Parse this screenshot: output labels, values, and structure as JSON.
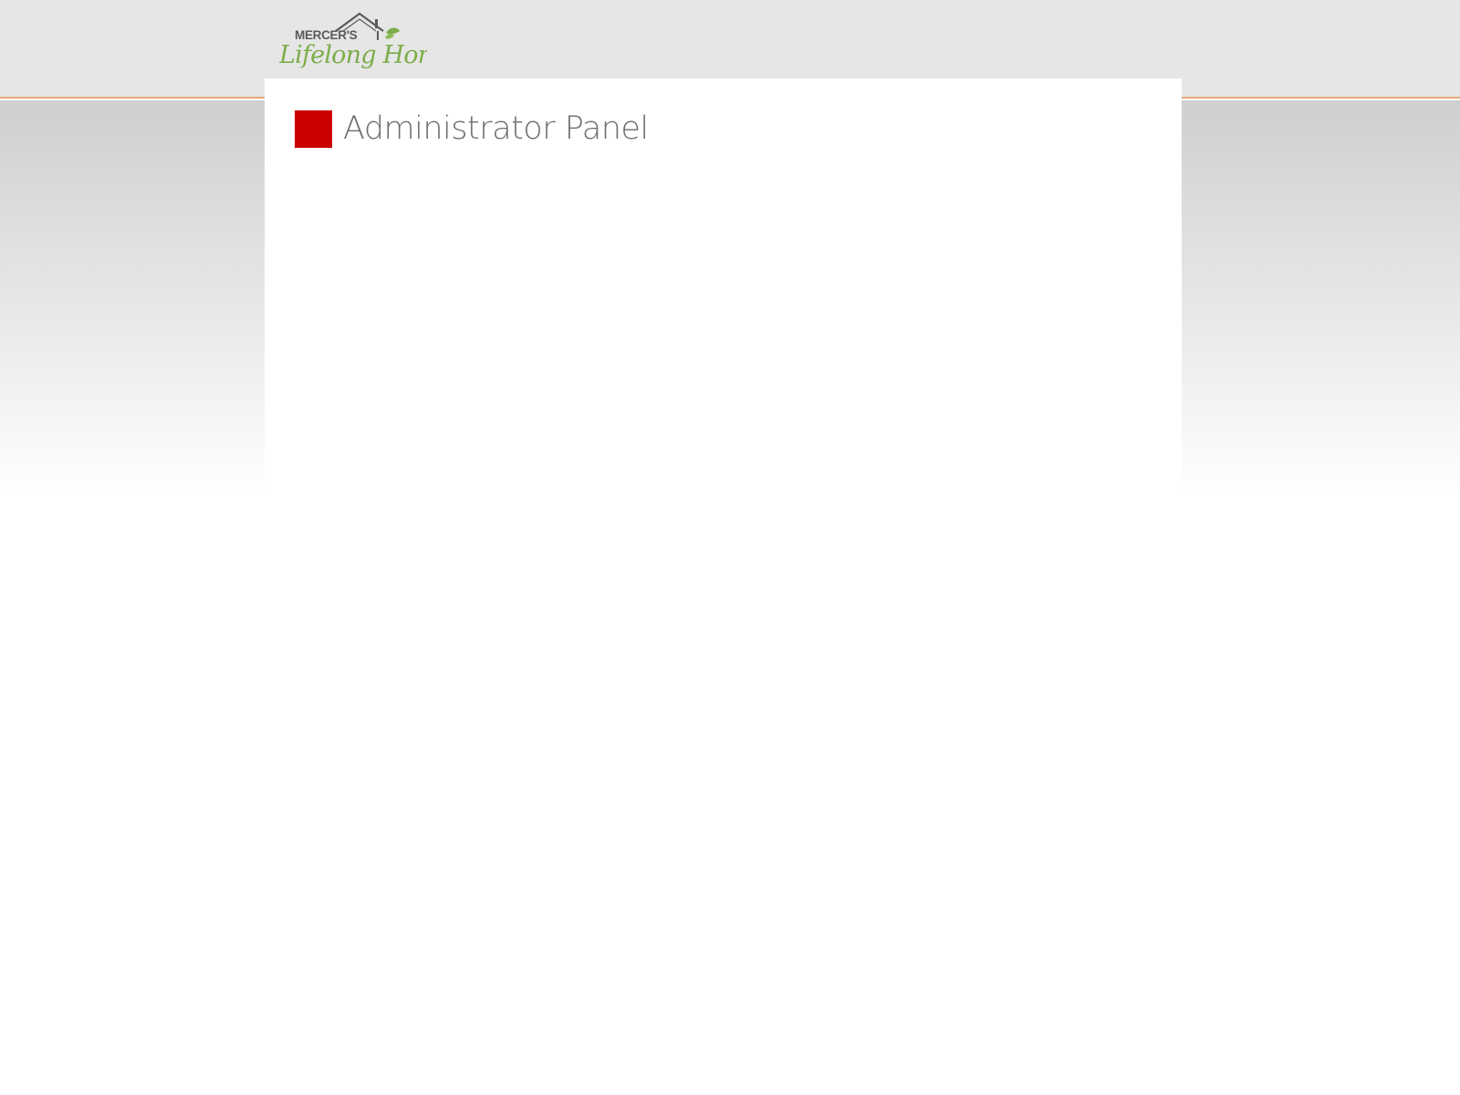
{
  "brand": {
    "name_top": "MERCER'S",
    "name_script": "Lifelong Homes",
    "script_color": "#7cad4a",
    "gray_color": "#5b5b5b"
  },
  "header": {
    "accent_line_color": "#e8a878"
  },
  "panel": {
    "title": "Administrator Panel",
    "title_icon": "red-square-icon",
    "title_icon_color": "#cc0000"
  }
}
